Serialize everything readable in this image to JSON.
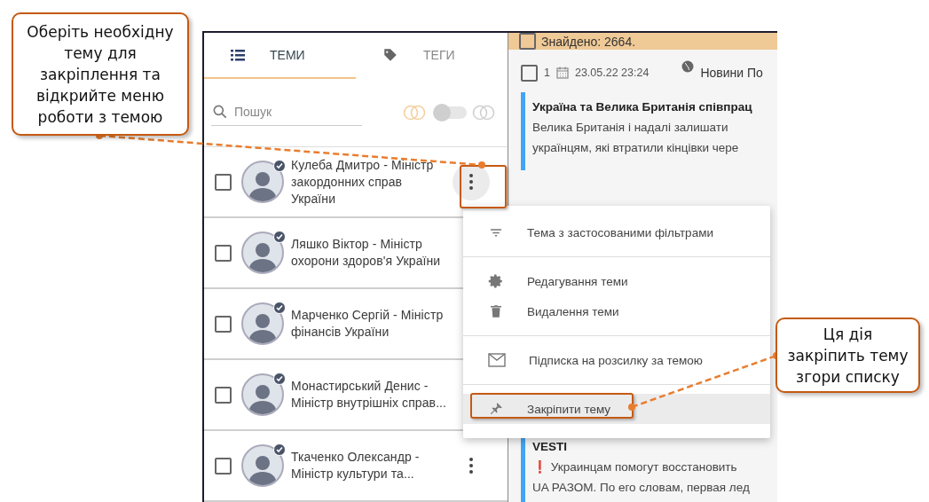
{
  "tabs": [
    {
      "label": "ТЕМИ",
      "kind": "list",
      "selected": true
    },
    {
      "label": "ТЕГИ",
      "kind": "tag",
      "selected": false
    }
  ],
  "search": {
    "placeholder": "Пошук"
  },
  "mode_switch": {
    "on": false
  },
  "topics": [
    {
      "name": "Кулеба Дмитро - Міністр закордонних справ України",
      "checked": false,
      "verified": true,
      "hovered": true
    },
    {
      "name": "Ляшко Віктор - Міністр охорони здоров'я України",
      "checked": false,
      "verified": true,
      "hovered": false
    },
    {
      "name": "Марченко Сергій - Міністр фінансів України",
      "checked": false,
      "verified": true,
      "hovered": false
    },
    {
      "name": "Монастирський Денис - Міністр внутрішніх справ...",
      "checked": false,
      "verified": true,
      "hovered": false
    },
    {
      "name": "Ткаченко Олександр - Міністр культури та...",
      "checked": false,
      "verified": true,
      "hovered": false
    }
  ],
  "results": {
    "label": "Знайдено: 2664.",
    "checked": false
  },
  "news": [
    {
      "number": "1",
      "checked": false,
      "date": "23.05.22 23:24",
      "source": "Новини По",
      "title": "Україна та Велика Британія співпрац",
      "lines": [
        "Велика Британія і надалі залишати",
        "українцям, які втратили кінцівки чере"
      ]
    },
    {
      "title": "VESTI",
      "lines": [
        "❗ Украинцам помогут восстановить",
        "UA РАЗОМ. По его словам, первая лед"
      ]
    }
  ],
  "context_menu": {
    "groups": [
      [
        {
          "kind": "filter",
          "label": "Тема з застосованими фільтрами",
          "highlighted": false
        }
      ],
      [
        {
          "kind": "edit",
          "label": "Редагування теми",
          "highlighted": false
        },
        {
          "kind": "delete",
          "label": "Видалення теми",
          "highlighted": false
        }
      ],
      [
        {
          "kind": "mail",
          "label": "Підписка на розсилку за темою",
          "highlighted": false
        }
      ],
      [
        {
          "kind": "pin",
          "label": "Закріпити тему",
          "highlighted": true
        }
      ]
    ]
  },
  "callouts": [
    {
      "text": "Оберіть необхідну тему для закріплення та відкрийте меню роботи з темою"
    },
    {
      "text": "Ця дія закріпить тему згори списку"
    }
  ]
}
